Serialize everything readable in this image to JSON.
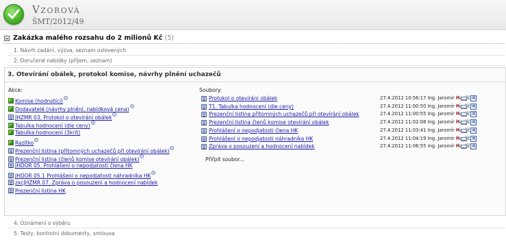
{
  "header": {
    "title": "Vzorová",
    "subtitle": "ŠMT/2012/49"
  },
  "main": {
    "title": "Zakázka malého rozsahu do 2 milionů Kč",
    "count": "(5)"
  },
  "steps": [
    "1. Návrh zadání, výzva, seznam oslovených",
    "2. Doručené nabídky (příjem, seznam)",
    "3. Otevírání obálek, protokol komise, návrhy plnění uchazečů",
    "4. Oznámení o výběru",
    "5. Testy, kontrolní dokumenty, smlouva"
  ],
  "actions_label": "Akce:",
  "files_label": "Soubory:",
  "actions": [
    {
      "label": "Komise (hodnotící)",
      "icon": "green-task-icon",
      "help": true
    },
    {
      "label": "Dodavatelé (návrhy plnění, nabídková cena)",
      "icon": "green-task-icon",
      "help": true
    },
    {
      "label": "JHZMR 03. Protokol o otevírání obálek",
      "icon": "document-icon",
      "help": true
    },
    {
      "label": "Tabulka hodnocení (dle ceny)",
      "icon": "green-task-icon",
      "help": true
    },
    {
      "label": "Tabulka hodnocení (3krit)",
      "icon": "green-task-icon",
      "help": false
    },
    {
      "label": "Razítko",
      "icon": "green-task-icon",
      "help": true
    },
    {
      "label": "Prezenční listina (přítomných uchazečů při otevírání obálek)",
      "icon": "document-icon",
      "help": true
    },
    {
      "label": "Prezenční listina (členů komise otevírání obálek)",
      "icon": "document-icon",
      "help": true
    },
    {
      "label": "JHDOR 05. Prohlášení o nepodjatosti člena HK",
      "icon": "document-icon",
      "help": false
    },
    {
      "label": "JHDOR 05.1 Prohlášení o nepodjatosti náhradníka HK",
      "icon": "document-icon",
      "help": true
    },
    {
      "label": "zxcJHZMR 07. Zpráva o posouzení a hodnocení nabídek",
      "icon": "document-icon",
      "help": false
    },
    {
      "label": "Prezenční listina HK",
      "icon": "document-icon",
      "help": false
    }
  ],
  "files": [
    {
      "name": "Protokol o otevírání obálek",
      "date": "27.4.2012 10:56:17 Ing. Jaromír Havlíček"
    },
    {
      "name": "T1. Tabulka hodnocení (dle ceny)",
      "date": "27.4.2012 11:00:50 Ing. Jaromír Havlíček"
    },
    {
      "name": "Prezenční listina přítomných uchazečů při otevírání obálek",
      "date": "27.4.2012 11:00:55 Ing. Jaromír Havlíček"
    },
    {
      "name": "Prezenční listina členů komise otevírání obálek",
      "date": "27.4.2012 11:02:08 Ing. Jaromír Havlíček"
    },
    {
      "name": "Prohlášení o nepodjatosti člena HK",
      "date": "27.4.2012 11:03:41 Ing. Jaromír Havlíček"
    },
    {
      "name": "Prohlášení o nepodjatosti náhradníka HK",
      "date": "27.4.2012 11:04:19 Ing. Jaromír Havlíček"
    },
    {
      "name": "Zpráva o posouzení a hodnocení nabídek",
      "date": "27.4.2012 11:06:55 Ing. Jaromír Havlíček"
    }
  ],
  "attach_label": "Přiřpit soubor...",
  "colors": {
    "link": "#1a1aa6",
    "delete": "#d21b1b",
    "check": "#4cb52a"
  }
}
